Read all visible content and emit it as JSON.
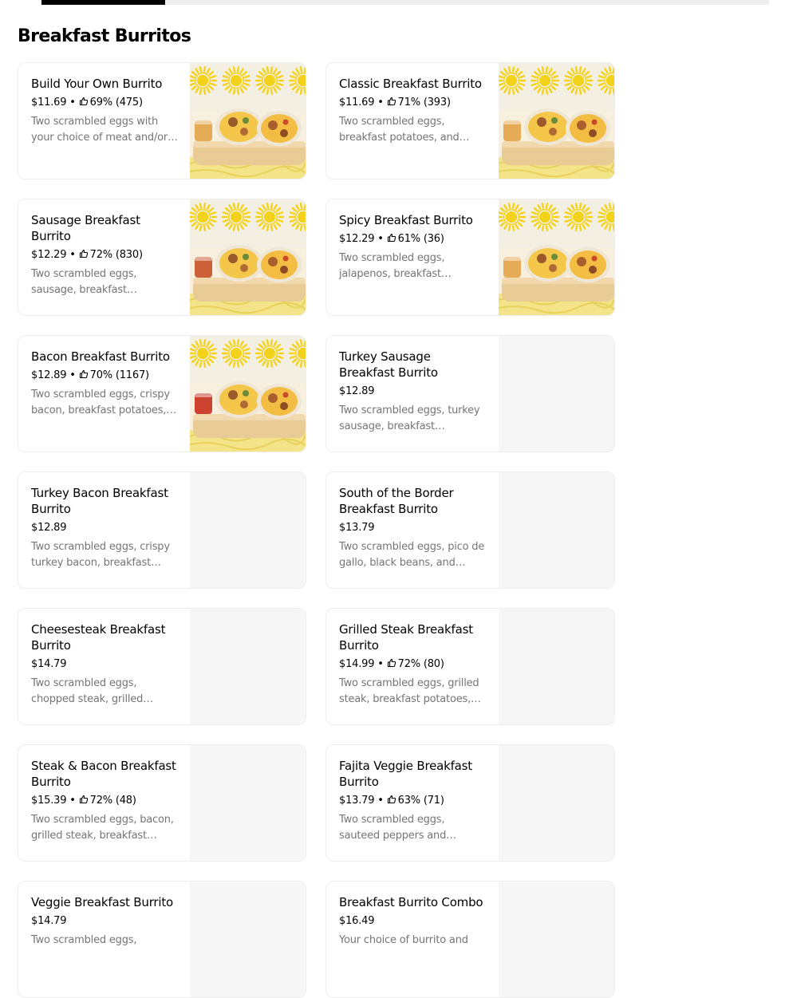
{
  "section": {
    "title": "Breakfast Burritos"
  },
  "progress": {
    "value": 0.17
  },
  "items": [
    {
      "name": "Build Your Own Burrito",
      "price": "$11.69",
      "rating": "69% (475)",
      "description": "Two scrambled eggs with your choice of meat and/or…",
      "has_image": true,
      "sauce": "#e3a54a"
    },
    {
      "name": "Classic Breakfast Burrito",
      "price": "$11.69",
      "rating": "71% (393)",
      "description": "Two scrambled eggs, breakfast potatoes, and…",
      "has_image": true,
      "sauce": "#e3a54a"
    },
    {
      "name": "Sausage Breakfast Burrito",
      "price": "$12.29",
      "rating": "72% (830)",
      "description": "Two scrambled eggs, sausage, breakfast…",
      "has_image": true,
      "sauce": "#c8552a"
    },
    {
      "name": "Spicy Breakfast Burrito",
      "price": "$12.29",
      "rating": "61% (36)",
      "description": "Two scrambled eggs, jalapenos, breakfast…",
      "has_image": true,
      "sauce": "#e3a54a"
    },
    {
      "name": "Bacon Breakfast Burrito",
      "price": "$12.89",
      "rating": "70% (1167)",
      "description": "Two scrambled eggs, crispy bacon, breakfast potatoes,…",
      "has_image": true,
      "sauce": "#c8331f"
    },
    {
      "name": "Turkey Sausage Breakfast Burrito",
      "price": "$12.89",
      "rating": null,
      "description": "Two scrambled eggs, turkey sausage, breakfast…",
      "has_image": false
    },
    {
      "name": "Turkey Bacon Breakfast Burrito",
      "price": "$12.89",
      "rating": null,
      "description": "Two scrambled eggs, crispy turkey bacon, breakfast…",
      "has_image": false
    },
    {
      "name": "South of the Border Breakfast Burrito",
      "price": "$13.79",
      "rating": null,
      "description": "Two scrambled eggs, pico de gallo, black beans, and…",
      "has_image": false
    },
    {
      "name": "Cheesesteak Breakfast Burrito",
      "price": "$14.79",
      "rating": null,
      "description": "Two scrambled eggs, chopped steak, grilled…",
      "has_image": false
    },
    {
      "name": "Grilled Steak Breakfast Burrito",
      "price": "$14.99",
      "rating": "72% (80)",
      "description": "Two scrambled eggs, grilled steak, breakfast potatoes,…",
      "has_image": false
    },
    {
      "name": "Steak & Bacon Breakfast Burrito",
      "price": "$15.39",
      "rating": "72% (48)",
      "description": "Two scrambled eggs, bacon, grilled steak, breakfast…",
      "has_image": false
    },
    {
      "name": "Fajita Veggie Breakfast Burrito",
      "price": "$13.79",
      "rating": "63% (71)",
      "description": "Two scrambled eggs, sauteed peppers and onion…",
      "has_image": false
    },
    {
      "name": "Veggie Breakfast Burrito",
      "price": "$14.79",
      "rating": null,
      "description": "Two scrambled eggs,",
      "has_image": false
    },
    {
      "name": "Breakfast Burrito Combo",
      "price": "$16.49",
      "rating": null,
      "description": "Your choice of burrito and",
      "has_image": false
    }
  ],
  "meta": {
    "separator": " • ",
    "rating_icon": "thumbs-up-icon",
    "placeholder_color": "#f6f6f6",
    "accent_yellow": "#f2d21a"
  }
}
